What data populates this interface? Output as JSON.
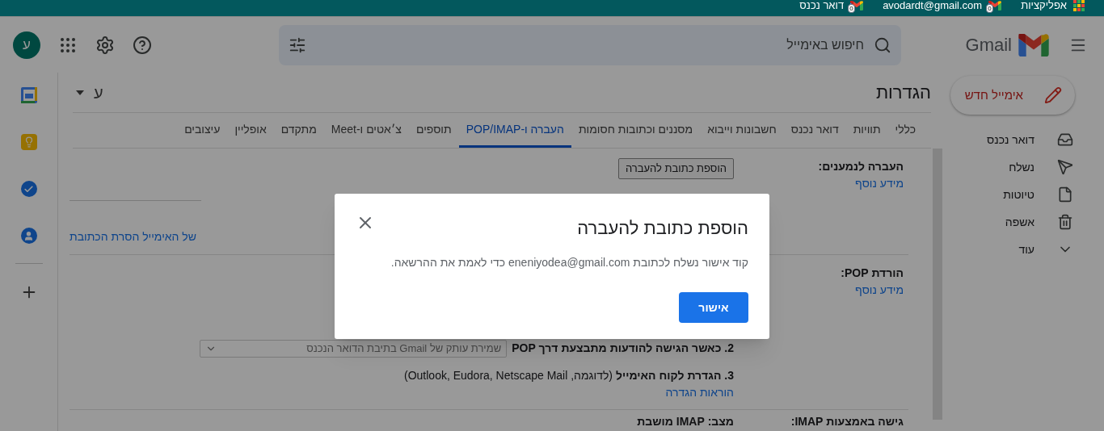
{
  "bookmarks_bar": [
    {
      "kind": "apps",
      "label": "אפליקציות"
    },
    {
      "kind": "mail",
      "label": "avodardt@gmail.com",
      "badge": "0"
    },
    {
      "kind": "mail",
      "label": "דואר נכנס",
      "badge": "0"
    }
  ],
  "header": {
    "product": "Gmail",
    "search": {
      "placeholder": "חיפוש באימייל"
    },
    "avatar": "ע"
  },
  "compose": "אימייל חדש",
  "nav": [
    {
      "kind": "inbox",
      "label": "דואר נכנס"
    },
    {
      "kind": "send",
      "label": "נשלח"
    },
    {
      "kind": "draft",
      "label": "טיוטות"
    },
    {
      "kind": "trash",
      "label": "אשפה"
    },
    {
      "kind": "more",
      "label": "עוד"
    }
  ],
  "settings": {
    "title": "הגדרות",
    "input_tool": "ע",
    "tabs": [
      {
        "label": "כללי",
        "selected": false
      },
      {
        "label": "תוויות",
        "selected": false
      },
      {
        "label": "דואר נכנס",
        "selected": false
      },
      {
        "label": "חשבונות וייבוא",
        "selected": false
      },
      {
        "label": "מסננים וכתובות חסומות",
        "selected": false
      },
      {
        "label": "העברה ו-POP/IMAP",
        "selected": true
      },
      {
        "label": "תוספים",
        "selected": false
      },
      {
        "label": "צ׳אטים ו-Meet",
        "selected": false
      },
      {
        "label": "מתקדם",
        "selected": false
      },
      {
        "label": "אופליין",
        "selected": false
      },
      {
        "label": "עיצובים",
        "selected": false
      }
    ],
    "forwarding": {
      "label": "העברה לנמענים:",
      "link": "מידע נוסף",
      "button": "הוספת כתובת להעברה",
      "partial_link": "של האימייל הסרת הכתובת"
    },
    "pop": {
      "label": "הורדת POP:",
      "link": "מידע נוסף",
      "step2": "2. כאשר הגישה להודעות מתבצעת דרך POP",
      "step2_select": "שמירת עותק של Gmail בתיבת הדואר הנכנס",
      "step3": "3. הגדרת לקוח האימייל",
      "step3_note": "(לדוגמה, Outlook, Eudora, Netscape Mail)",
      "step3_link": "הוראות הגדרה"
    },
    "imap": {
      "label": "גישה באמצעות IMAP:",
      "status": "מצב: IMAP מושבת"
    }
  },
  "dialog": {
    "title": "הוספת כתובת להעברה",
    "body": "קוד אישור נשלח לכתובת eneniyodea@gmail.com כדי לאמת את ההרשאה.",
    "button": "אישור"
  }
}
